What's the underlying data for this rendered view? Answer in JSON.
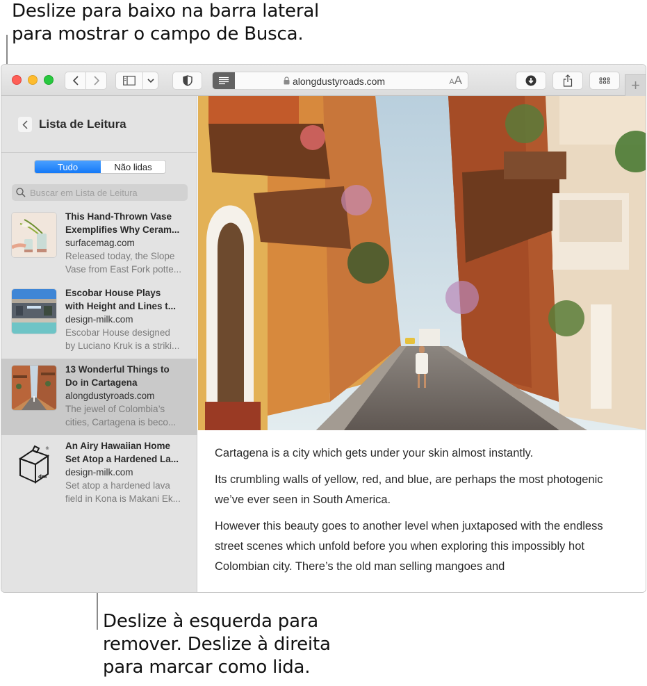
{
  "callouts": {
    "top": {
      "line1": "Deslize para baixo na barra lateral",
      "line2": "para mostrar o campo de Busca."
    },
    "bottom": {
      "line1": "Deslize à esquerda para",
      "line2": "remover. Deslize à direita",
      "line3": "para marcar como lida."
    }
  },
  "toolbar": {
    "url": "alongdustyroads.com",
    "text_size_label_small": "A",
    "text_size_label_big": "A",
    "new_tab_label": "+",
    "icons": [
      "back-icon",
      "forward-icon",
      "sidebar-icon",
      "chevron-down-icon",
      "privacy-shield-icon",
      "reader-icon",
      "lock-icon",
      "download-icon",
      "share-icon",
      "tab-overview-icon",
      "new-tab-icon"
    ]
  },
  "sidebar": {
    "title": "Lista de Leitura",
    "segments": [
      {
        "label": "Tudo",
        "active": true
      },
      {
        "label": "Não lidas",
        "active": false
      }
    ],
    "search_placeholder": "Buscar em Lista de Leitura",
    "items": [
      {
        "title_line1": "This Hand-Thrown Vase",
        "title_line2": "Exemplifies Why Ceram...",
        "domain": "surfacemag.com",
        "desc_line1": "Released today, the Slope",
        "desc_line2": "Vase from East Fork potte...",
        "selected": false
      },
      {
        "title_line1": "Escobar House Plays",
        "title_line2": "with Height and Lines t...",
        "domain": "design-milk.com",
        "desc_line1": "Escobar House designed",
        "desc_line2": "by Luciano Kruk is a striki...",
        "selected": false
      },
      {
        "title_line1": "13 Wonderful Things to",
        "title_line2": "Do in Cartagena",
        "domain": "alongdustyroads.com",
        "desc_line1": "The jewel of Colombia’s",
        "desc_line2": "cities, Cartagena is beco...",
        "selected": true
      },
      {
        "title_line1": "An Airy Hawaiian Home",
        "title_line2": "Set Atop a Hardened La...",
        "domain": "design-milk.com",
        "desc_line1": "Set atop a hardened lava",
        "desc_line2": "field in Kona is Makani Ek...",
        "selected": false,
        "logo_text": "dm",
        "logo_mark": "®"
      }
    ]
  },
  "article": {
    "paragraphs": [
      "Cartagena is a city which gets under your skin almost instantly.",
      "Its crumbling walls of yellow, red, and blue, are perhaps the most photogenic we’ve ever seen in South America.",
      "However this beauty goes to another level when juxtaposed with the endless street scenes which unfold before you when exploring this impossibly hot Colombian city. There’s the old man selling mangoes and"
    ]
  },
  "colors": {
    "accent": "#1479f7",
    "close": "#fe5f57",
    "minimize": "#febc2e",
    "maximize": "#28c840",
    "sidebar_bg": "#e3e3e3",
    "selected_row": "#c9c9c9"
  }
}
